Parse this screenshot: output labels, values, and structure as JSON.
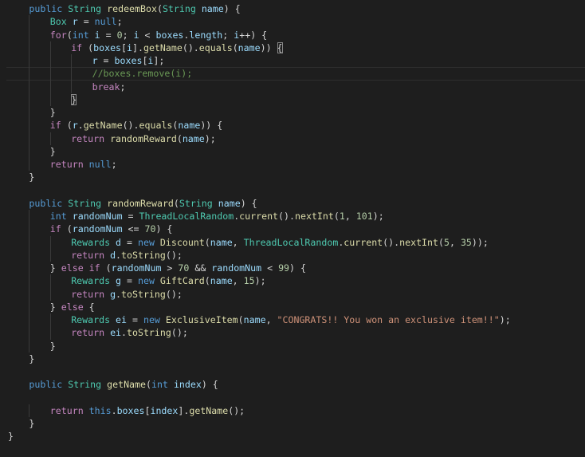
{
  "editor": {
    "indent_size": 4,
    "highlighted_line": 5,
    "colors": {
      "background": "#1e1e1e",
      "keyword": "#569cd6",
      "control": "#c586c0",
      "type": "#4ec9b0",
      "function": "#dcdcaa",
      "variable": "#9cdcfe",
      "number": "#b5cea8",
      "string": "#ce9178",
      "comment": "#6a9955"
    },
    "lines": [
      {
        "indent": 1,
        "tokens": [
          [
            "k",
            "public"
          ],
          [
            "p",
            " "
          ],
          [
            "t",
            "String"
          ],
          [
            "p",
            " "
          ],
          [
            "f",
            "redeemBox"
          ],
          [
            "p",
            "("
          ],
          [
            "t",
            "String"
          ],
          [
            "p",
            " "
          ],
          [
            "v",
            "name"
          ],
          [
            "p",
            ") {"
          ]
        ]
      },
      {
        "indent": 2,
        "tokens": [
          [
            "t",
            "Box"
          ],
          [
            "p",
            " "
          ],
          [
            "v",
            "r"
          ],
          [
            "p",
            " = "
          ],
          [
            "k",
            "null"
          ],
          [
            "p",
            ";"
          ]
        ]
      },
      {
        "indent": 2,
        "tokens": [
          [
            "c",
            "for"
          ],
          [
            "p",
            "("
          ],
          [
            "k",
            "int"
          ],
          [
            "p",
            " "
          ],
          [
            "v",
            "i"
          ],
          [
            "p",
            " = "
          ],
          [
            "n",
            "0"
          ],
          [
            "p",
            "; "
          ],
          [
            "v",
            "i"
          ],
          [
            "p",
            " < "
          ],
          [
            "v",
            "boxes"
          ],
          [
            "p",
            "."
          ],
          [
            "v",
            "length"
          ],
          [
            "p",
            "; "
          ],
          [
            "v",
            "i"
          ],
          [
            "p",
            "++) {"
          ]
        ]
      },
      {
        "indent": 3,
        "tokens": [
          [
            "c",
            "if"
          ],
          [
            "p",
            " ("
          ],
          [
            "v",
            "boxes"
          ],
          [
            "p",
            "["
          ],
          [
            "v",
            "i"
          ],
          [
            "p",
            "]."
          ],
          [
            "f",
            "getName"
          ],
          [
            "p",
            "()."
          ],
          [
            "f",
            "equals"
          ],
          [
            "p",
            "("
          ],
          [
            "v",
            "name"
          ],
          [
            "p",
            ")) "
          ],
          [
            "bm",
            "{"
          ]
        ]
      },
      {
        "indent": 4,
        "tokens": [
          [
            "v",
            "r"
          ],
          [
            "p",
            " = "
          ],
          [
            "v",
            "boxes"
          ],
          [
            "p",
            "["
          ],
          [
            "v",
            "i"
          ],
          [
            "p",
            "];"
          ]
        ]
      },
      {
        "indent": 4,
        "tokens": [
          [
            "cm",
            "//boxes.remove(i);"
          ]
        ]
      },
      {
        "indent": 4,
        "tokens": [
          [
            "c",
            "break"
          ],
          [
            "p",
            ";"
          ]
        ]
      },
      {
        "indent": 3,
        "tokens": [
          [
            "bm",
            "}"
          ]
        ]
      },
      {
        "indent": 2,
        "tokens": [
          [
            "p",
            "}"
          ]
        ]
      },
      {
        "indent": 2,
        "tokens": [
          [
            "c",
            "if"
          ],
          [
            "p",
            " ("
          ],
          [
            "v",
            "r"
          ],
          [
            "p",
            "."
          ],
          [
            "f",
            "getName"
          ],
          [
            "p",
            "()."
          ],
          [
            "f",
            "equals"
          ],
          [
            "p",
            "("
          ],
          [
            "v",
            "name"
          ],
          [
            "p",
            ")) {"
          ]
        ]
      },
      {
        "indent": 3,
        "tokens": [
          [
            "c",
            "return"
          ],
          [
            "p",
            " "
          ],
          [
            "f",
            "randomReward"
          ],
          [
            "p",
            "("
          ],
          [
            "v",
            "name"
          ],
          [
            "p",
            ");"
          ]
        ]
      },
      {
        "indent": 2,
        "tokens": [
          [
            "p",
            "}"
          ]
        ]
      },
      {
        "indent": 2,
        "tokens": [
          [
            "c",
            "return"
          ],
          [
            "p",
            " "
          ],
          [
            "k",
            "null"
          ],
          [
            "p",
            ";"
          ]
        ]
      },
      {
        "indent": 1,
        "tokens": [
          [
            "p",
            "}"
          ]
        ]
      },
      {
        "indent": 0,
        "tokens": []
      },
      {
        "indent": 1,
        "tokens": [
          [
            "k",
            "public"
          ],
          [
            "p",
            " "
          ],
          [
            "t",
            "String"
          ],
          [
            "p",
            " "
          ],
          [
            "f",
            "randomReward"
          ],
          [
            "p",
            "("
          ],
          [
            "t",
            "String"
          ],
          [
            "p",
            " "
          ],
          [
            "v",
            "name"
          ],
          [
            "p",
            ") {"
          ]
        ]
      },
      {
        "indent": 2,
        "tokens": [
          [
            "k",
            "int"
          ],
          [
            "p",
            " "
          ],
          [
            "v",
            "randomNum"
          ],
          [
            "p",
            " = "
          ],
          [
            "t",
            "ThreadLocalRandom"
          ],
          [
            "p",
            "."
          ],
          [
            "f",
            "current"
          ],
          [
            "p",
            "()."
          ],
          [
            "f",
            "nextInt"
          ],
          [
            "p",
            "("
          ],
          [
            "n",
            "1"
          ],
          [
            "p",
            ", "
          ],
          [
            "n",
            "101"
          ],
          [
            "p",
            ");"
          ]
        ]
      },
      {
        "indent": 2,
        "tokens": [
          [
            "c",
            "if"
          ],
          [
            "p",
            " ("
          ],
          [
            "v",
            "randomNum"
          ],
          [
            "p",
            " <= "
          ],
          [
            "n",
            "70"
          ],
          [
            "p",
            ") {"
          ]
        ]
      },
      {
        "indent": 3,
        "tokens": [
          [
            "t",
            "Rewards"
          ],
          [
            "p",
            " "
          ],
          [
            "v",
            "d"
          ],
          [
            "p",
            " = "
          ],
          [
            "k",
            "new"
          ],
          [
            "p",
            " "
          ],
          [
            "f",
            "Discount"
          ],
          [
            "p",
            "("
          ],
          [
            "v",
            "name"
          ],
          [
            "p",
            ", "
          ],
          [
            "t",
            "ThreadLocalRandom"
          ],
          [
            "p",
            "."
          ],
          [
            "f",
            "current"
          ],
          [
            "p",
            "()."
          ],
          [
            "f",
            "nextInt"
          ],
          [
            "p",
            "("
          ],
          [
            "n",
            "5"
          ],
          [
            "p",
            ", "
          ],
          [
            "n",
            "35"
          ],
          [
            "p",
            "));"
          ]
        ]
      },
      {
        "indent": 3,
        "tokens": [
          [
            "c",
            "return"
          ],
          [
            "p",
            " "
          ],
          [
            "v",
            "d"
          ],
          [
            "p",
            "."
          ],
          [
            "f",
            "toString"
          ],
          [
            "p",
            "();"
          ]
        ]
      },
      {
        "indent": 2,
        "tokens": [
          [
            "p",
            "} "
          ],
          [
            "c",
            "else"
          ],
          [
            "p",
            " "
          ],
          [
            "c",
            "if"
          ],
          [
            "p",
            " ("
          ],
          [
            "v",
            "randomNum"
          ],
          [
            "p",
            " > "
          ],
          [
            "n",
            "70"
          ],
          [
            "p",
            " && "
          ],
          [
            "v",
            "randomNum"
          ],
          [
            "p",
            " < "
          ],
          [
            "n",
            "99"
          ],
          [
            "p",
            ") {"
          ]
        ]
      },
      {
        "indent": 3,
        "tokens": [
          [
            "t",
            "Rewards"
          ],
          [
            "p",
            " "
          ],
          [
            "v",
            "g"
          ],
          [
            "p",
            " = "
          ],
          [
            "k",
            "new"
          ],
          [
            "p",
            " "
          ],
          [
            "f",
            "GiftCard"
          ],
          [
            "p",
            "("
          ],
          [
            "v",
            "name"
          ],
          [
            "p",
            ", "
          ],
          [
            "n",
            "15"
          ],
          [
            "p",
            ");"
          ]
        ]
      },
      {
        "indent": 3,
        "tokens": [
          [
            "c",
            "return"
          ],
          [
            "p",
            " "
          ],
          [
            "v",
            "g"
          ],
          [
            "p",
            "."
          ],
          [
            "f",
            "toString"
          ],
          [
            "p",
            "();"
          ]
        ]
      },
      {
        "indent": 2,
        "tokens": [
          [
            "p",
            "} "
          ],
          [
            "c",
            "else"
          ],
          [
            "p",
            " {"
          ]
        ]
      },
      {
        "indent": 3,
        "tokens": [
          [
            "t",
            "Rewards"
          ],
          [
            "p",
            " "
          ],
          [
            "v",
            "ei"
          ],
          [
            "p",
            " = "
          ],
          [
            "k",
            "new"
          ],
          [
            "p",
            " "
          ],
          [
            "f",
            "ExclusiveItem"
          ],
          [
            "p",
            "("
          ],
          [
            "v",
            "name"
          ],
          [
            "p",
            ", "
          ],
          [
            "s",
            "\"CONGRATS!! You won an exclusive item!!\""
          ],
          [
            "p",
            ");"
          ]
        ]
      },
      {
        "indent": 3,
        "tokens": [
          [
            "c",
            "return"
          ],
          [
            "p",
            " "
          ],
          [
            "v",
            "ei"
          ],
          [
            "p",
            "."
          ],
          [
            "f",
            "toString"
          ],
          [
            "p",
            "();"
          ]
        ]
      },
      {
        "indent": 2,
        "tokens": [
          [
            "p",
            "}"
          ]
        ]
      },
      {
        "indent": 1,
        "tokens": [
          [
            "p",
            "}"
          ]
        ]
      },
      {
        "indent": 0,
        "tokens": []
      },
      {
        "indent": 1,
        "tokens": [
          [
            "k",
            "public"
          ],
          [
            "p",
            " "
          ],
          [
            "t",
            "String"
          ],
          [
            "p",
            " "
          ],
          [
            "f",
            "getName"
          ],
          [
            "p",
            "("
          ],
          [
            "k",
            "int"
          ],
          [
            "p",
            " "
          ],
          [
            "v",
            "index"
          ],
          [
            "p",
            ") {"
          ]
        ]
      },
      {
        "indent": 0,
        "tokens": []
      },
      {
        "indent": 2,
        "tokens": [
          [
            "c",
            "return"
          ],
          [
            "p",
            " "
          ],
          [
            "k",
            "this"
          ],
          [
            "p",
            "."
          ],
          [
            "v",
            "boxes"
          ],
          [
            "p",
            "["
          ],
          [
            "v",
            "index"
          ],
          [
            "p",
            "]."
          ],
          [
            "f",
            "getName"
          ],
          [
            "p",
            "();"
          ]
        ]
      },
      {
        "indent": 1,
        "tokens": [
          [
            "p",
            "}"
          ]
        ]
      },
      {
        "indent": 0,
        "tokens": [
          [
            "p",
            "}"
          ]
        ]
      }
    ]
  }
}
